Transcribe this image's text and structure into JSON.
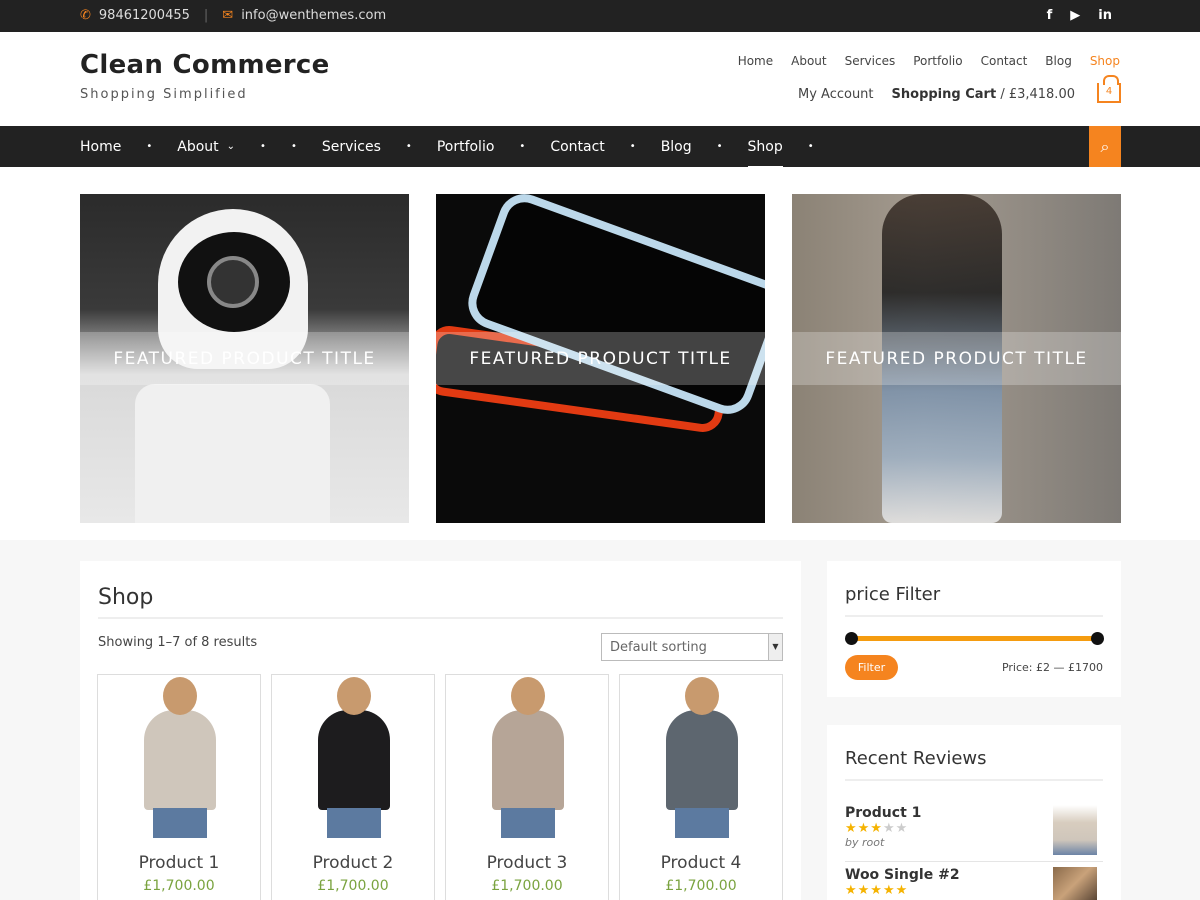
{
  "topbar": {
    "phone": "98461200455",
    "email": "info@wenthemes.com"
  },
  "header": {
    "site_title": "Clean Commerce",
    "tagline": "Shopping Simplified",
    "top_nav": [
      "Home",
      "About",
      "Services",
      "Portfolio",
      "Contact",
      "Blog",
      "Shop"
    ],
    "active_top_nav": "Shop",
    "my_account": "My Account",
    "cart_label": "Shopping Cart",
    "cart_total": "/ £3,418.00",
    "cart_count": "4"
  },
  "main_nav": {
    "items": [
      "Home",
      "About",
      "Services",
      "Portfolio",
      "Contact",
      "Blog",
      "Shop"
    ],
    "active": "Shop"
  },
  "featured": [
    {
      "title": "FEATURED PRODUCT TITLE"
    },
    {
      "title": "FEATURED PRODUCT TITLE"
    },
    {
      "title": "FEATURED PRODUCT TITLE"
    }
  ],
  "shop": {
    "title": "Shop",
    "result_count": "Showing 1–7 of 8 results",
    "sorting": "Default sorting",
    "products": [
      {
        "name": "Product 1",
        "price": "£1,700.00",
        "color": "#cfc6bb"
      },
      {
        "name": "Product 2",
        "price": "£1,700.00",
        "color": "#1d1c1e"
      },
      {
        "name": "Product 3",
        "price": "£1,700.00",
        "color": "#b6a597"
      },
      {
        "name": "Product 4",
        "price": "£1,700.00",
        "color": "#5d666f"
      }
    ]
  },
  "sidebar": {
    "price_filter": {
      "title": "price Filter",
      "button": "Filter",
      "range": "Price: £2 — £1700"
    },
    "recent_reviews": {
      "title": "Recent Reviews",
      "items": [
        {
          "name": "Product 1",
          "rating": 3,
          "by": "by root"
        },
        {
          "name": "Woo Single #2",
          "rating": 5,
          "by": ""
        }
      ]
    }
  },
  "colors": {
    "accent": "#f5841f",
    "dark_bar": "#222222",
    "price_green": "#7aa33f",
    "slider": "#f59c10"
  }
}
